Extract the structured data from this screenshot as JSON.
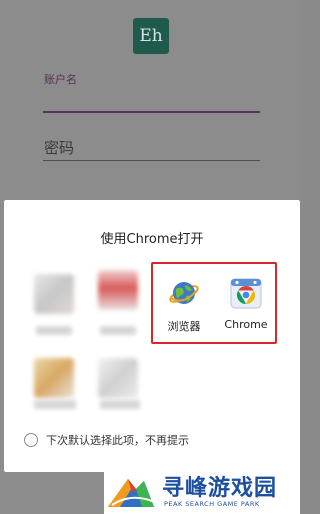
{
  "app": {
    "logo_text": "Eh"
  },
  "login": {
    "username_label": "账户名",
    "password_placeholder": "密码"
  },
  "dialog": {
    "title": "使用Chrome打开",
    "apps": [
      {
        "label": "浏览器",
        "icon": "globe-browser-icon"
      },
      {
        "label": "Chrome",
        "icon": "chrome-icon"
      }
    ],
    "remember_text": "下次默认选择此项，不再提示",
    "highlight_color": "#d9262a"
  },
  "watermark": {
    "title": "寻峰游戏园",
    "subtitle": "PEAK SEARCH GAME PARK"
  }
}
